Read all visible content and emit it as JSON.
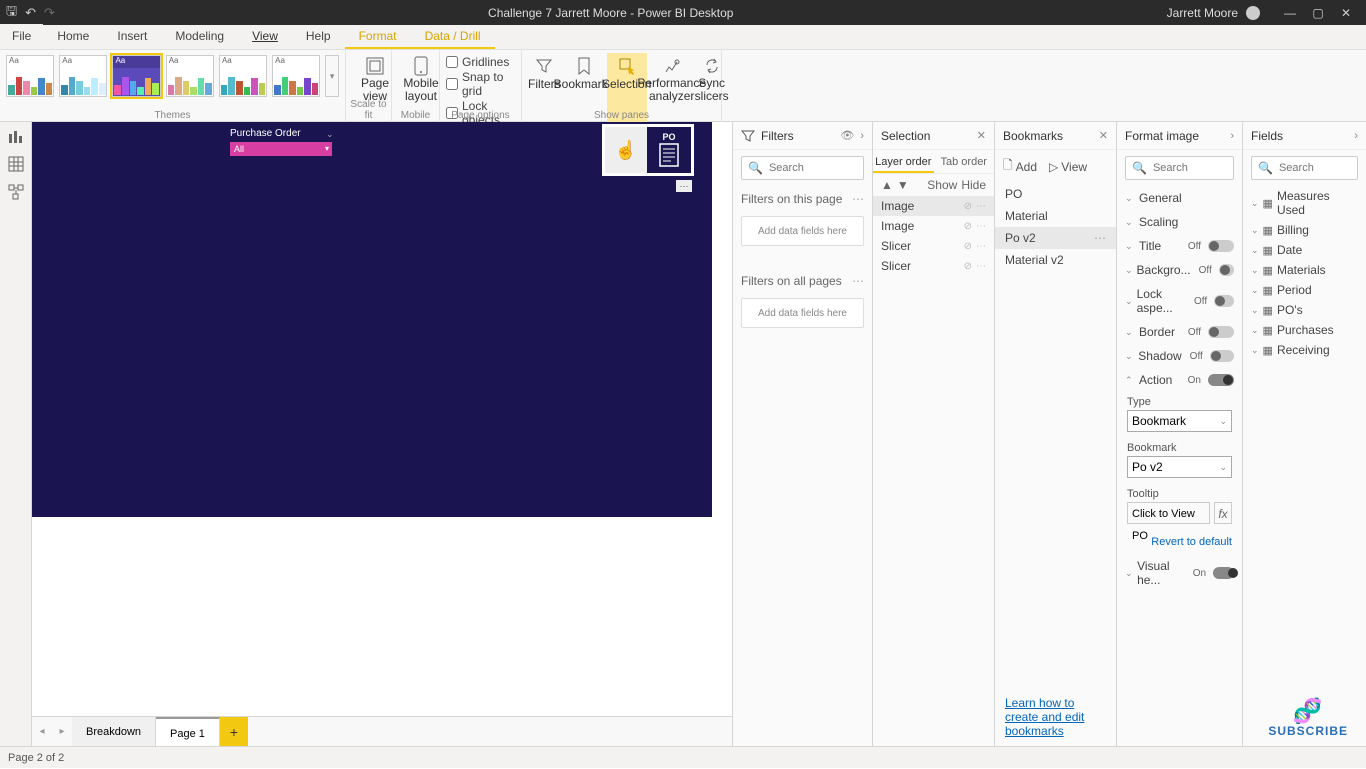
{
  "titlebar": {
    "title": "Challenge 7 Jarrett Moore - Power BI Desktop",
    "user": "Jarrett Moore"
  },
  "menus": {
    "file": "File",
    "tabs": [
      "Home",
      "Insert",
      "Modeling",
      "View",
      "Help",
      "Format",
      "Data / Drill"
    ],
    "active": 3,
    "selected": [
      5,
      6
    ]
  },
  "ribbon": {
    "themes_lbl": "Themes",
    "scale_lbl": "Scale to fit",
    "mobile_lbl": "Mobile",
    "pageopts_lbl": "Page options",
    "showpanes_lbl": "Show panes",
    "page_view": "Page view",
    "mobile_layout": "Mobile layout",
    "gridlines": "Gridlines",
    "snap": "Snap to grid",
    "lock": "Lock objects",
    "filters": "Filters",
    "bookmarks": "Bookmarks",
    "selection": "Selection",
    "perf": "Performance analyzer",
    "sync": "Sync slicers"
  },
  "canvas": {
    "po_header": "Purchase Order",
    "po_value": "All",
    "img_label": "PO"
  },
  "tabs": {
    "pages": [
      "Breakdown",
      "Page 1"
    ],
    "active": 1
  },
  "filters": {
    "title": "Filters",
    "search_ph": "Search",
    "this_page": "Filters on this page",
    "all_pages": "Filters on all pages",
    "add_here": "Add data fields here"
  },
  "selection": {
    "title": "Selection",
    "layer": "Layer order",
    "tab": "Tab order",
    "show": "Show",
    "hide": "Hide",
    "items": [
      "Image",
      "Image",
      "Slicer",
      "Slicer"
    ]
  },
  "bookmarks": {
    "title": "Bookmarks",
    "add": "Add",
    "view": "View",
    "items": [
      "PO",
      "Material",
      "Po v2",
      "Material v2"
    ],
    "selected": 2,
    "link": "Learn how to create and edit bookmarks"
  },
  "format": {
    "title": "Format image",
    "search_ph": "Search",
    "rows": [
      {
        "label": "General",
        "toggle": null
      },
      {
        "label": "Scaling",
        "toggle": null
      },
      {
        "label": "Title",
        "toggle": "Off"
      },
      {
        "label": "Backgro...",
        "toggle": "Off"
      },
      {
        "label": "Lock aspe...",
        "toggle": "Off"
      },
      {
        "label": "Border",
        "toggle": "Off"
      },
      {
        "label": "Shadow",
        "toggle": "Off"
      },
      {
        "label": "Action",
        "toggle": "On",
        "open": true
      }
    ],
    "type_lbl": "Type",
    "type_val": "Bookmark",
    "bm_lbl": "Bookmark",
    "bm_val": "Po v2",
    "tt_lbl": "Tooltip",
    "tt_val": "Click to View PO",
    "revert": "Revert to default",
    "visual_he": {
      "label": "Visual he...",
      "toggle": "On"
    }
  },
  "fields": {
    "title": "Fields",
    "search_ph": "Search",
    "tables": [
      "Measures Used",
      "Billing",
      "Date",
      "Materials",
      "Period",
      "PO's",
      "Purchases",
      "Receiving"
    ]
  },
  "status": "Page 2 of 2",
  "subscribe": "SUBSCRIBE"
}
